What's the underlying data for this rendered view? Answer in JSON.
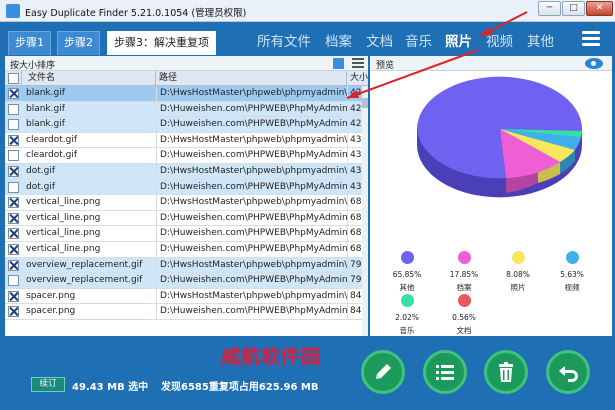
{
  "window": {
    "title": "Easy Duplicate Finder 5.21.0.1054 (管理员权限)",
    "min_label": "─",
    "max_label": "□",
    "close_label": "✕"
  },
  "steps": {
    "step1": "步骤1",
    "step2": "步骤2",
    "step3": "步骤3：解决重复项"
  },
  "categories": [
    "所有文件",
    "档案",
    "文档",
    "音乐",
    "照片",
    "视频",
    "其他"
  ],
  "active_category": "照片",
  "toolbar": {
    "sort_label": "按大小排序"
  },
  "table": {
    "headers": {
      "name": "文件名",
      "path": "路径",
      "size": "大小"
    },
    "rows": [
      {
        "checked": true,
        "name": "blank.gif",
        "path": "D:\\HwsHostMaster\\phpweb\\phpmyadmin\\we...",
        "size": "42",
        "style": "sel"
      },
      {
        "checked": false,
        "name": "blank.gif",
        "path": "D:\\Huweishen.com\\PHPWEB\\PhpMyAdmin\\...",
        "size": "42",
        "style": "hl"
      },
      {
        "checked": false,
        "name": "blank.gif",
        "path": "D:\\Huweishen.com\\PHPWEB\\PhpMyAdmin\\...",
        "size": "42",
        "style": "hl"
      },
      {
        "checked": true,
        "name": "cleardot.gif",
        "path": "D:\\HwsHostMaster\\phpweb\\phpmyadmin\\we...",
        "size": "43",
        "style": ""
      },
      {
        "checked": false,
        "name": "cleardot.gif",
        "path": "D:\\Huweishen.com\\PHPWEB\\PhpMyAdmin\\...",
        "size": "43",
        "style": ""
      },
      {
        "checked": true,
        "name": "dot.gif",
        "path": "D:\\HwsHostMaster\\phpweb\\phpmyadmin\\we...",
        "size": "43",
        "style": "hl"
      },
      {
        "checked": false,
        "name": "dot.gif",
        "path": "D:\\Huweishen.com\\PHPWEB\\PhpMyAdmin\\...",
        "size": "43",
        "style": "hl"
      },
      {
        "checked": true,
        "name": "vertical_line.png",
        "path": "D:\\HwsHostMaster\\phpweb\\phpmyadmin\\we...",
        "size": "68",
        "style": ""
      },
      {
        "checked": true,
        "name": "vertical_line.png",
        "path": "D:\\Huweishen.com\\PHPWEB\\PhpMyAdmin\\...",
        "size": "68",
        "style": ""
      },
      {
        "checked": true,
        "name": "vertical_line.png",
        "path": "D:\\Huweishen.com\\PHPWEB\\PhpMyAdmin\\...",
        "size": "68",
        "style": ""
      },
      {
        "checked": true,
        "name": "vertical_line.png",
        "path": "D:\\Huweishen.com\\PHPWEB\\PhpMyAdmin\\...",
        "size": "68",
        "style": ""
      },
      {
        "checked": true,
        "name": "overview_replacement.gif",
        "path": "D:\\HwsHostMaster\\phpweb\\phpmyadmin\\we...",
        "size": "79",
        "style": "hl"
      },
      {
        "checked": false,
        "name": "overview_replacement.gif",
        "path": "D:\\Huweishen.com\\PHPWEB\\PhpMyAdmin\\...",
        "size": "79",
        "style": "hl"
      },
      {
        "checked": true,
        "name": "spacer.png",
        "path": "D:\\HwsHostMaster\\phpweb\\phpmyadmin\\we...",
        "size": "84",
        "style": ""
      },
      {
        "checked": true,
        "name": "spacer.png",
        "path": "D:\\Huweishen.com\\PHPWEB\\PhpMyAdmin\\...",
        "size": "84",
        "style": ""
      }
    ]
  },
  "preview": {
    "label": "预览",
    "legend": [
      {
        "pct": "65.85%",
        "label": "其他",
        "color": "#6f62f0"
      },
      {
        "pct": "17.85%",
        "label": "档案",
        "color": "#f05ed6"
      },
      {
        "pct": "8.08%",
        "label": "照片",
        "color": "#f7e75c"
      },
      {
        "pct": "5.63%",
        "label": "视频",
        "color": "#3fb0ec"
      },
      {
        "pct": "2.02%",
        "label": "音乐",
        "color": "#38e0a4"
      },
      {
        "pct": "0.56%",
        "label": "文档",
        "color": "#e85a5a"
      }
    ]
  },
  "status": {
    "pause_label": "续订",
    "selected_size": "49.43 MB 选中",
    "found_summary": "发现6585重复项占用625.96 MB",
    "watermark": "威航软件园"
  },
  "actions": [
    "pencil-icon",
    "list-icon",
    "trash-icon",
    "undo-icon"
  ],
  "colors": {
    "accent": "#1f6fb4",
    "action_button": "#1c9a5c",
    "annotation_arrow": "#e0202a"
  }
}
